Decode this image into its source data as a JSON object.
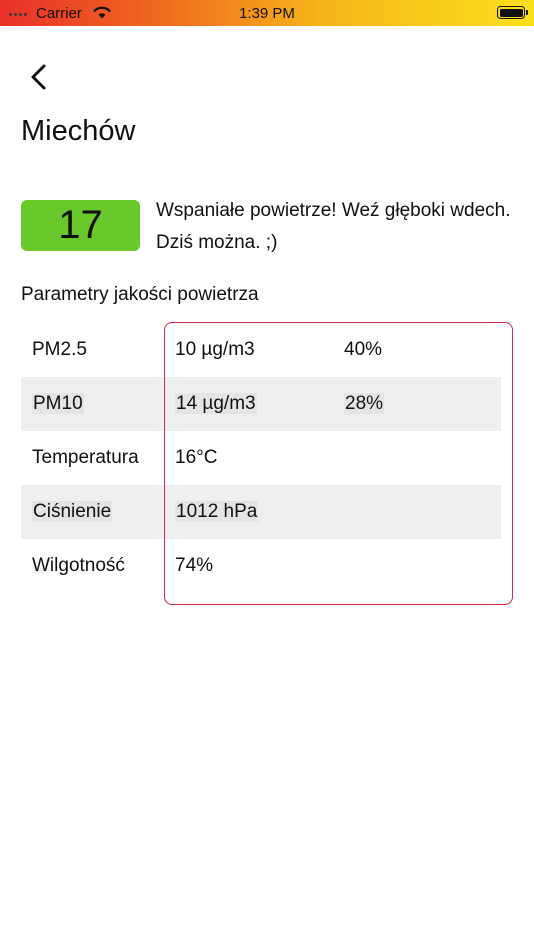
{
  "status_bar": {
    "carrier": "Carrier",
    "time": "1:39 PM"
  },
  "header": {
    "back_icon": "chevron-left-icon",
    "city": "Miechów"
  },
  "summary": {
    "aqi_value": "17",
    "aqi_color": "#69c82a",
    "message": "Wspaniałe powietrze! Weź głęboki wdech. Dziś można. ;)"
  },
  "parameters": {
    "title": "Parametry jakości powietrza",
    "highlight_color": "#d9264a",
    "rows": [
      {
        "name": "PM2.5",
        "value": "10 µg/m3",
        "percent": "40%"
      },
      {
        "name": "PM10",
        "value": "14 µg/m3",
        "percent": "28%"
      },
      {
        "name": "Temperatura",
        "value": "16°C",
        "percent": ""
      },
      {
        "name": "Ciśnienie",
        "value": "1012 hPa",
        "percent": ""
      },
      {
        "name": "Wilgotność",
        "value": "74%",
        "percent": ""
      }
    ]
  }
}
